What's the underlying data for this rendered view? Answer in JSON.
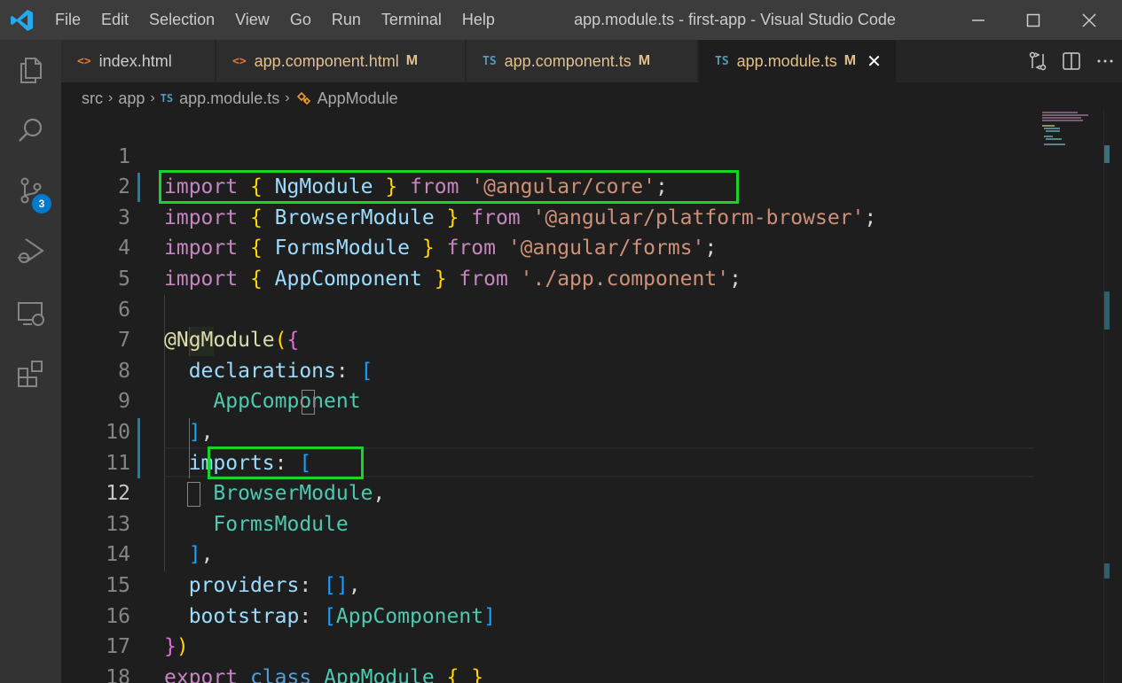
{
  "titlebar": {
    "menu": [
      "File",
      "Edit",
      "Selection",
      "View",
      "Go",
      "Run",
      "Terminal",
      "Help"
    ],
    "title": "app.module.ts - first-app - Visual Studio Code"
  },
  "activity": {
    "scm_badge": "3"
  },
  "tabs": [
    {
      "icon": "<>",
      "label": "index.html",
      "modified": ""
    },
    {
      "icon": "<>",
      "label": "app.component.html",
      "modified": "M"
    },
    {
      "icon": "TS",
      "label": "app.component.ts",
      "modified": "M"
    },
    {
      "icon": "TS",
      "label": "app.module.ts",
      "modified": "M"
    }
  ],
  "breadcrumbs": {
    "parts": [
      "src",
      "app"
    ],
    "file_icon": "TS",
    "file": "app.module.ts",
    "symbol": "AppModule"
  },
  "editor": {
    "line_numbers": [
      "1",
      "2",
      "3",
      "4",
      "5",
      "6",
      "7",
      "8",
      "9",
      "10",
      "11",
      "12",
      "13",
      "14",
      "15",
      "16",
      "17",
      "18"
    ],
    "current_line": "12",
    "tokens": {
      "import": "import",
      "from": "from",
      "ngmodule": "NgModule",
      "browsermodule": "BrowserModule",
      "formsmodule": "FormsModule",
      "appcomponent": "AppComponent",
      "core": "'@angular/core'",
      "platform": "'@angular/platform-browser'",
      "forms": "'@angular/forms'",
      "appcomp_path": "'./app.component'",
      "decorator": "@NgModule",
      "declarations": "declarations",
      "imports": "imports",
      "providers": "providers",
      "bootstrap": "bootstrap",
      "export": "export",
      "class": "class",
      "appmodule": "AppModule"
    }
  },
  "colors": {
    "highlight_box": "#19d32a",
    "accent": "#007acc"
  }
}
